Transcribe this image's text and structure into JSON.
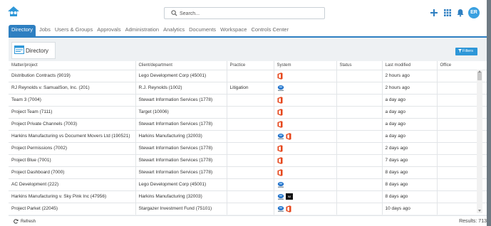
{
  "search": {
    "placeholder": "Search..."
  },
  "user": {
    "initials": "ER"
  },
  "colors": {
    "accent": "#2e7fc1",
    "office_orange": "#e6471c",
    "avatar": "#3aa0e0"
  },
  "tabs": [
    {
      "label": "Directory",
      "active": true
    },
    {
      "label": "Jobs"
    },
    {
      "label": "Users & Groups"
    },
    {
      "label": "Approvals"
    },
    {
      "label": "Administration"
    },
    {
      "label": "Analytics"
    },
    {
      "label": "Documents"
    },
    {
      "label": "Workspace"
    },
    {
      "label": "Controls Center"
    }
  ],
  "directory": {
    "title": "Directory",
    "filters_label": "Filters"
  },
  "table": {
    "columns": [
      "Matter/project",
      "Client/department",
      "Practice",
      "System",
      "Status",
      "Last modified",
      "Office"
    ],
    "rows": [
      {
        "matter": "Distribution Contracts (9019)",
        "client": "Lego Development Corp (45001)",
        "practice": "",
        "system": [
          "office-icon"
        ],
        "status": "",
        "modified": "2 hours ago",
        "office": ""
      },
      {
        "matter": "RJ Reynolds v. SamualSon, Inc. (201)",
        "client": "R.J. Reynolds (1002)",
        "practice": "Litigation",
        "system": [
          "netdocs-icon"
        ],
        "status": "",
        "modified": "2 hours ago",
        "office": ""
      },
      {
        "matter": "Team 3 (7004)",
        "client": "Stewart Information Services (1778)",
        "practice": "",
        "system": [
          "office-icon"
        ],
        "status": "",
        "modified": "a day ago",
        "office": ""
      },
      {
        "matter": "Project Team (7111)",
        "client": "Target (10006)",
        "practice": "",
        "system": [
          "office-icon"
        ],
        "status": "",
        "modified": "a day ago",
        "office": ""
      },
      {
        "matter": "Project Private Channels (7003)",
        "client": "Stewart Information Services (1778)",
        "practice": "",
        "system": [
          "office-icon"
        ],
        "status": "",
        "modified": "a day ago",
        "office": ""
      },
      {
        "matter": "Harkins Manufacturing vs Document Movers Ltd (190521)",
        "client": "Harkins Manufacturing (32003)",
        "practice": "",
        "system": [
          "netdocs-icon",
          "office-icon"
        ],
        "status": "",
        "modified": "a day ago",
        "office": ""
      },
      {
        "matter": "Project Permissions (7002)",
        "client": "Stewart Information Services (1778)",
        "practice": "",
        "system": [
          "office-icon"
        ],
        "status": "",
        "modified": "2 days ago",
        "office": ""
      },
      {
        "matter": "Project Blue (7001)",
        "client": "Stewart Information Services (1778)",
        "practice": "",
        "system": [
          "office-icon"
        ],
        "status": "",
        "modified": "7 days ago",
        "office": ""
      },
      {
        "matter": "Project Dashboard (7000)",
        "client": "Stewart Information Services (1778)",
        "practice": "",
        "system": [
          "office-icon"
        ],
        "status": "",
        "modified": "8 days ago",
        "office": ""
      },
      {
        "matter": "AC Development (222)",
        "client": "Lego Development Corp (45001)",
        "practice": "",
        "system": [
          "netdocs-icon"
        ],
        "status": "",
        "modified": "8 days ago",
        "office": ""
      },
      {
        "matter": "Harkins Manufacturing v. Sky Pink Inc (47956)",
        "client": "Harkins Manufacturing (32003)",
        "practice": "",
        "system": [
          "netdocs-icon",
          "imanage-icon"
        ],
        "status": "",
        "modified": "8 days ago",
        "office": ""
      },
      {
        "matter": "Project Parket (22045)",
        "client": "Stargazer Investment Fund (75101)",
        "practice": "",
        "system": [
          "netdocs-icon",
          "office-icon"
        ],
        "status": "",
        "modified": "10 days ago",
        "office": ""
      },
      {
        "matter": "",
        "client": "",
        "practice": "",
        "system": [
          "netdocs-icon",
          "office-icon"
        ],
        "status": "",
        "modified": "",
        "office": ""
      }
    ]
  },
  "footer": {
    "refresh_label": "Refresh",
    "results": "Results: 713"
  }
}
